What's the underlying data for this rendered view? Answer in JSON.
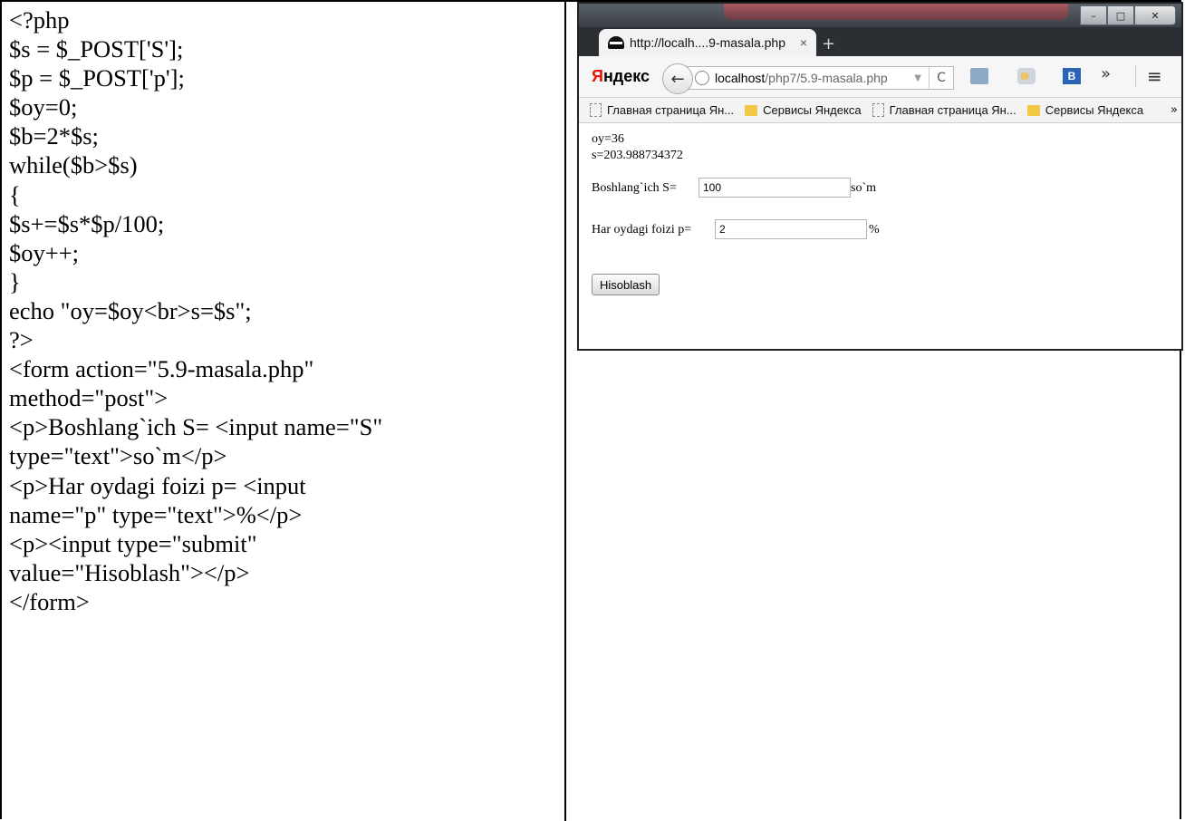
{
  "code": {
    "lines": [
      "<?php",
      "$s = $_POST['S'];",
      "$p = $_POST['p'];",
      "$oy=0;",
      "$b=2*$s;",
      "while($b>$s)",
      "{",
      "$s+=$s*$p/100;",
      "$oy++;",
      "}",
      "echo \"oy=$oy<br>s=$s\";",
      "?>",
      "<form action=\"5.9-masala.php\"",
      "method=\"post\">",
      "<p>Boshlang`ich S= <input name=\"S\"",
      "type=\"text\">so`m</p>",
      "<p>Har oydagi foizi p= <input",
      "name=\"p\" type=\"text\">%</p>",
      "<p><input type=\"submit\"",
      "value=\"Hisoblash\"></p>",
      "</form>"
    ]
  },
  "browser": {
    "window_controls": {
      "minimize": "–",
      "maximize": "□",
      "close": "✕"
    },
    "tab": {
      "title": "http://localh....9-masala.php",
      "close": "×",
      "icon": "incognito-icon"
    },
    "new_tab": "+",
    "nav": {
      "logo_first": "Я",
      "logo_rest": "ндекс",
      "back": "←",
      "url_host": "localhost",
      "url_path": "/php7/5.9-masala.php",
      "reload": "C",
      "b_icon_letter": "B",
      "overflow": "»",
      "menu": "≡"
    },
    "bookmarks": [
      {
        "label": "Главная страница Ян...",
        "icon": "page-icon"
      },
      {
        "label": "Сервисы Яндекса",
        "icon": "folder-icon"
      },
      {
        "label": "Главная страница Ян...",
        "icon": "page-icon"
      },
      {
        "label": "Сервисы Яндекса",
        "icon": "folder-icon"
      }
    ],
    "bookmarks_more": "»",
    "page": {
      "output_line1": "oy=36",
      "output_line2": "s=203.988734372",
      "s_label": "Boshlang`ich S=",
      "s_value": "100",
      "s_unit": "so`m",
      "p_label": "Har oydagi foizi p=",
      "p_value": "2",
      "p_unit": "%",
      "submit": "Hisoblash"
    }
  }
}
